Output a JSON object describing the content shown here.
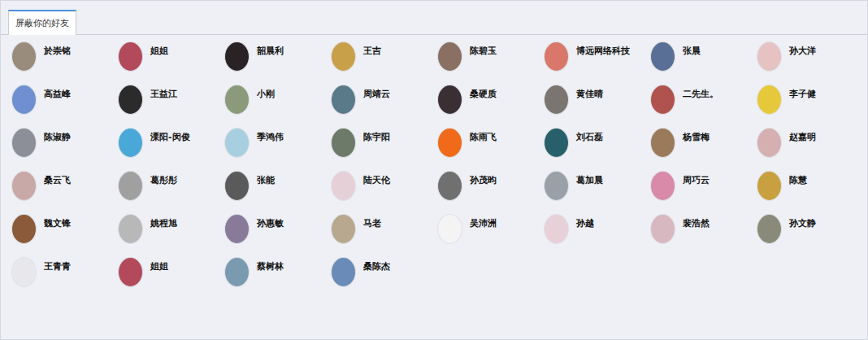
{
  "tabs": [
    {
      "label": "屏蔽你的好友",
      "selected": true
    }
  ],
  "friends": [
    {
      "name": "於崇铭",
      "color": "#9a8c7c"
    },
    {
      "name": "姐姐",
      "color": "#b24a5c"
    },
    {
      "name": "韶晨利",
      "color": "#2a2326"
    },
    {
      "name": "王吉",
      "color": "#c9a04a"
    },
    {
      "name": "陈碧玉",
      "color": "#8a6f63"
    },
    {
      "name": "博远网络科技",
      "color": "#d9786a"
    },
    {
      "name": "张晨",
      "color": "#5a6f95"
    },
    {
      "name": "孙大洋",
      "color": "#e7c2c3"
    },
    {
      "name": "高益峰",
      "color": "#6f8fd0"
    },
    {
      "name": "王益江",
      "color": "#2b2b2b"
    },
    {
      "name": "小刚",
      "color": "#8a9a7a"
    },
    {
      "name": "周靖云",
      "color": "#5a7a8a"
    },
    {
      "name": "桑硬质",
      "color": "#3a3034"
    },
    {
      "name": "黄佳晴",
      "color": "#7a7570"
    },
    {
      "name": "二先生。",
      "color": "#b0524e"
    },
    {
      "name": "李子健",
      "color": "#e6c93a"
    },
    {
      "name": "陈淑静",
      "color": "#8c8f98"
    },
    {
      "name": "溧阳-闵俊",
      "color": "#4aa8d8"
    },
    {
      "name": "季鸿伟",
      "color": "#a8cfe0"
    },
    {
      "name": "陈宇阳",
      "color": "#6d7a6a"
    },
    {
      "name": "陈雨飞",
      "color": "#f06a1a"
    },
    {
      "name": "刘石磊",
      "color": "#27606a"
    },
    {
      "name": "杨雪梅",
      "color": "#9a7a5a"
    },
    {
      "name": "赵嘉明",
      "color": "#d6b0b0"
    },
    {
      "name": "桑云飞",
      "color": "#c9a8a8"
    },
    {
      "name": "葛彤彤",
      "color": "#a0a0a0"
    },
    {
      "name": "张能",
      "color": "#5a5a5a"
    },
    {
      "name": "陆天伦",
      "color": "#e6d0d8"
    },
    {
      "name": "孙茂昀",
      "color": "#707070"
    },
    {
      "name": "葛加晨",
      "color": "#9aa0a8"
    },
    {
      "name": "周巧云",
      "color": "#d88aa8"
    },
    {
      "name": "陈慧",
      "color": "#c9a040"
    },
    {
      "name": "魏文锋",
      "color": "#8a5a3a"
    },
    {
      "name": "姚程旭",
      "color": "#b8b8b8"
    },
    {
      "name": "孙惠敏",
      "color": "#8a7a9a"
    },
    {
      "name": "马老",
      "color": "#b8a890"
    },
    {
      "name": "吴沛洲",
      "color": "#f4f4f4"
    },
    {
      "name": "孙越",
      "color": "#e8d0d8"
    },
    {
      "name": "裴浩然",
      "color": "#d8b8c0"
    },
    {
      "name": "孙文静",
      "color": "#8a8a7a"
    },
    {
      "name": "王青青",
      "color": "#e8e8ec"
    },
    {
      "name": "姐姐",
      "color": "#b24a5c"
    },
    {
      "name": "蔡树林",
      "color": "#7a9ab0"
    },
    {
      "name": "桑陈杰",
      "color": "#6a8ab8"
    }
  ]
}
